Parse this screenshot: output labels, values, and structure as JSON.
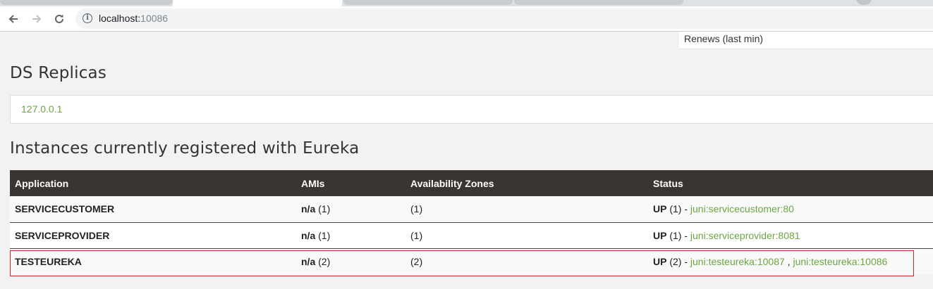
{
  "browser": {
    "url_host": "localhost:",
    "url_port": "10086"
  },
  "stats": {
    "renews_label": "Renews (last min)"
  },
  "replicas": {
    "title": "DS Replicas",
    "items": [
      "127.0.0.1"
    ]
  },
  "instances": {
    "title": "Instances currently registered with Eureka",
    "columns": [
      "Application",
      "AMIs",
      "Availability Zones",
      "Status"
    ],
    "rows": [
      {
        "application": "SERVICECUSTOMER",
        "ami_bold": "n/a",
        "ami_count": " (1)",
        "zones": "(1)",
        "status_bold": "UP",
        "status_count": " (1) - ",
        "links": [
          "juni:servicecustomer:80"
        ]
      },
      {
        "application": "SERVICEPROVIDER",
        "ami_bold": "n/a",
        "ami_count": " (1)",
        "zones": "(1)",
        "status_bold": "UP",
        "status_count": " (1) - ",
        "links": [
          "juni:serviceprovider:8081"
        ]
      },
      {
        "application": "TESTEUREKA",
        "ami_bold": "n/a",
        "ami_count": " (2)",
        "zones": "(2)",
        "status_bold": "UP",
        "status_count": " (2) - ",
        "links": [
          "juni:testeureka:10087",
          "juni:testeureka:10086"
        ],
        "link_separator": " , "
      }
    ]
  },
  "colors": {
    "header_bg": "#3a3530",
    "link_green": "#6da543",
    "highlight_red": "#c8282a"
  }
}
